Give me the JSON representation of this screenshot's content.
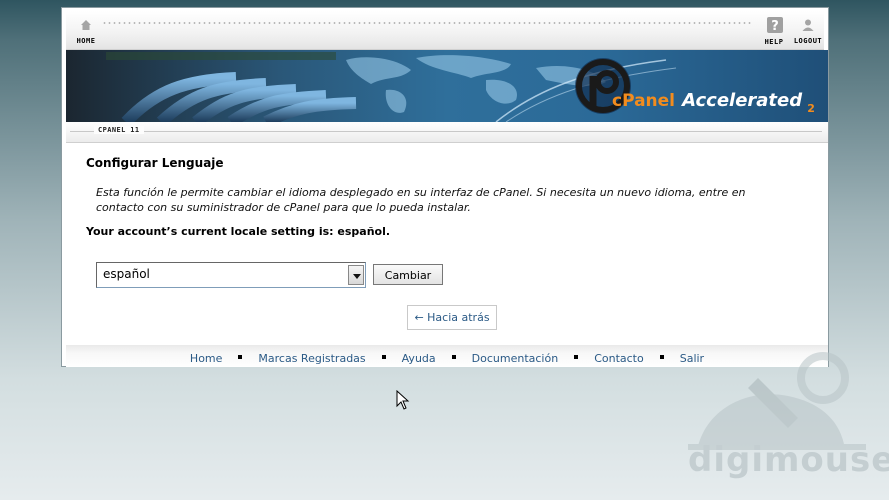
{
  "toolbar": {
    "home_label": "HOME",
    "help_label": "HELP",
    "logout_label": "LOGOUT"
  },
  "banner": {
    "logo_text": "cPanel",
    "logo_accent": "Accelerated",
    "logo_sub": "2",
    "brand_orange": "#f28c1e",
    "brand_blue": "#1f3f7a"
  },
  "subbar": {
    "version": "CPANEL 11"
  },
  "main": {
    "title": "Configurar Lenguaje",
    "description": "Esta función le permite cambiar el idioma desplegado en su interfaz de cPanel. Si necesita un nuevo idioma, entre en contacto con su suministrador de cPanel para que lo pueda instalar.",
    "locale_line": "Your account’s current locale setting is: español.",
    "select_value": "español",
    "change_button": "Cambiar",
    "back_link": "← Hacia atrás"
  },
  "footer": {
    "links": [
      "Home",
      "Marcas Registradas",
      "Ayuda",
      "Documentación",
      "Contacto",
      "Salir"
    ]
  },
  "watermark": {
    "text": "digimouse"
  }
}
